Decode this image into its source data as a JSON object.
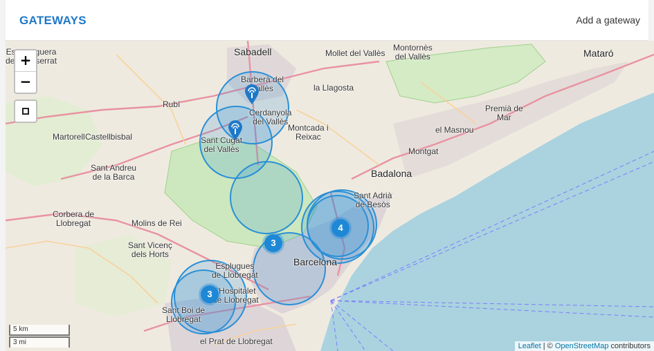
{
  "header": {
    "title": "GATEWAYS",
    "add_link": "Add a gateway"
  },
  "controls": {
    "zoom_in": "+",
    "zoom_out": "−"
  },
  "scale": {
    "km": "5 km",
    "mi": "3 mi"
  },
  "attribution": {
    "leaflet": "Leaflet",
    "sep": " | © ",
    "osm": "OpenStreetMap",
    "suffix": " contributors"
  },
  "clusters": [
    {
      "count": "4"
    },
    {
      "count": "3"
    },
    {
      "count": "3"
    }
  ],
  "places": [
    {
      "text": "Sabadell",
      "big": true
    },
    {
      "text": "Mataró",
      "big": true
    },
    {
      "text": "Badalona",
      "big": true
    },
    {
      "text": "Barcelona",
      "big": true
    },
    {
      "text": "Mollet del Vallès"
    },
    {
      "text": "Montornès\ndel Vallès"
    },
    {
      "text": "Barberà del\nVallès"
    },
    {
      "text": "la Llagosta"
    },
    {
      "text": "Cerdanyola\ndel Vallès"
    },
    {
      "text": "Montcada i\nReixac"
    },
    {
      "text": "Sant Cugat\ndel Vallès"
    },
    {
      "text": "Rubí"
    },
    {
      "text": "Castellbisbal"
    },
    {
      "text": "Martorell"
    },
    {
      "text": "Sant Andreu\nde la Barca"
    },
    {
      "text": "Corbera de\nLlobregat"
    },
    {
      "text": "Molins de Rei"
    },
    {
      "text": "Sant Vicenç\ndels Horts"
    },
    {
      "text": "Esplugues\nde Llobregat"
    },
    {
      "text": "l'Hospitalet\nde Llobregat"
    },
    {
      "text": "Sant Boi de\nLlobregat"
    },
    {
      "text": "el Prat de Llobregat"
    },
    {
      "text": "Sant Adrià\nde Besòs"
    },
    {
      "text": "Montgat"
    },
    {
      "text": "el Masnou"
    },
    {
      "text": "Premià de\nMar"
    },
    {
      "text": "Esparreguera\nde Montserrat"
    }
  ]
}
